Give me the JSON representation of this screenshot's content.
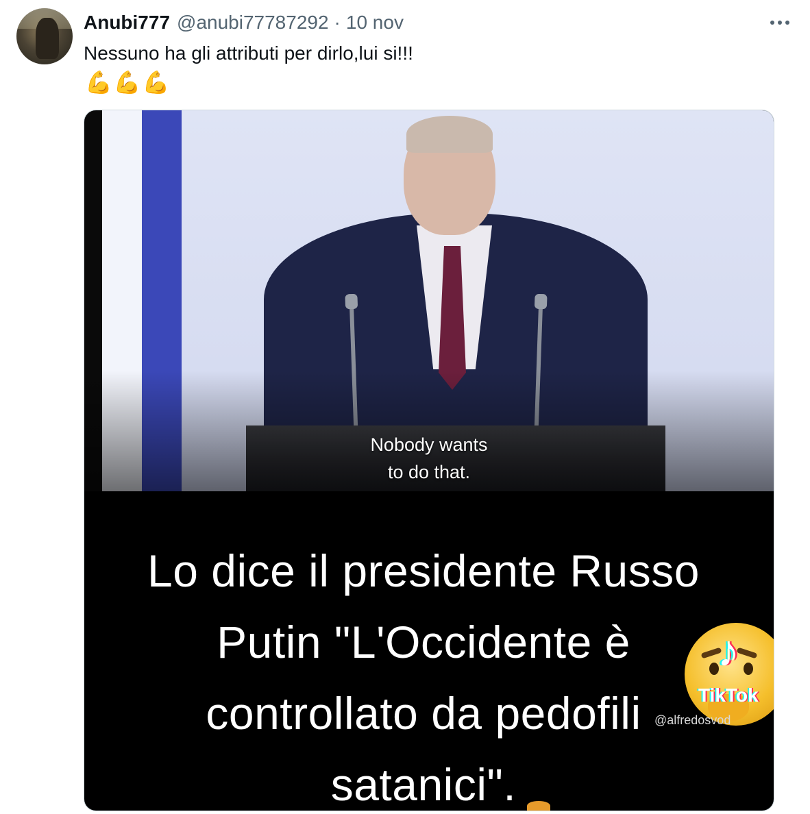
{
  "tweet": {
    "display_name": "Anubi777",
    "handle": "@anubi77787292",
    "separator": "·",
    "date": "10 nov",
    "text": "Nessuno ha gli attributi per dirlo,lui si!!!",
    "emojis": "💪💪💪",
    "more_icon": "more-horizontal-icon"
  },
  "media": {
    "subtitle_lines": [
      "Nobody wants",
      "to do that."
    ],
    "caption_lines": [
      "Lo dice il presidente Russo",
      "Putin \"L'Occidente è",
      "controllato da pedofili",
      "satanici\"."
    ],
    "watermark": {
      "brand": "TikTok",
      "username": "@alfredosvod"
    }
  }
}
